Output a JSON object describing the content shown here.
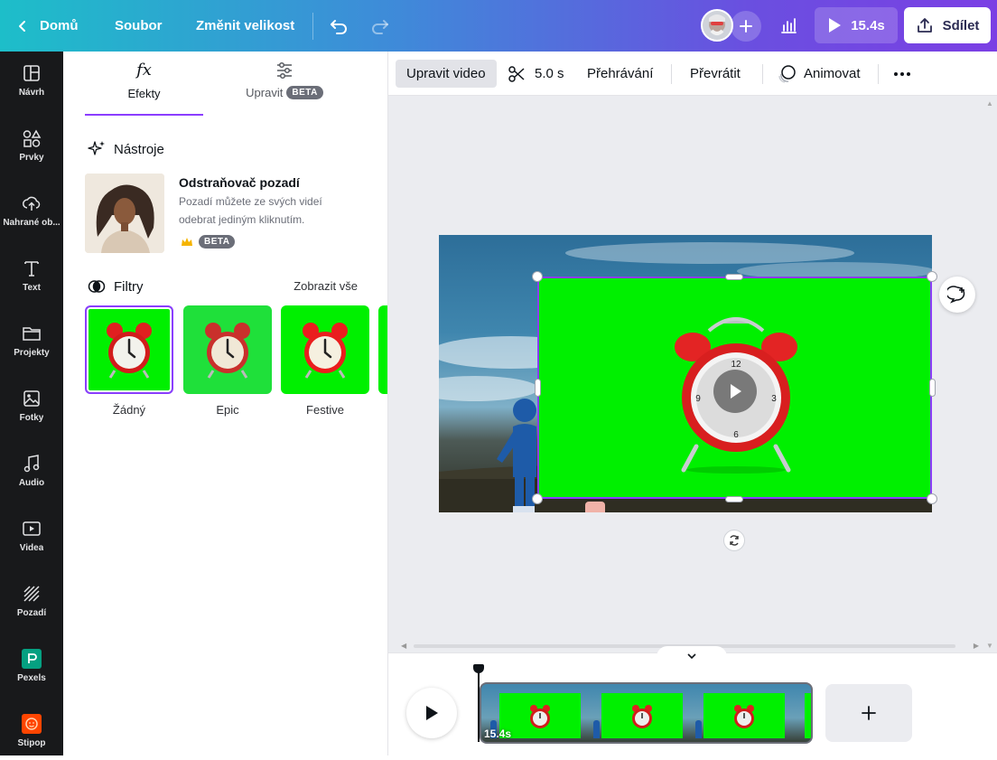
{
  "topbar": {
    "home": "Domů",
    "file": "Soubor",
    "resize": "Změnit velikost",
    "duration": "15.4s",
    "share": "Sdílet",
    "icons": [
      "chevron-left-icon",
      "undo-icon",
      "redo-icon",
      "plus-icon",
      "analytics-icon",
      "play-icon",
      "share-icon"
    ]
  },
  "sidenav": {
    "items": [
      {
        "label": "Návrh",
        "icon": "design-icon"
      },
      {
        "label": "Prvky",
        "icon": "elements-icon"
      },
      {
        "label": "Nahrané ob...",
        "icon": "upload-icon"
      },
      {
        "label": "Text",
        "icon": "text-icon"
      },
      {
        "label": "Projekty",
        "icon": "folder-icon"
      },
      {
        "label": "Fotky",
        "icon": "photo-icon"
      },
      {
        "label": "Audio",
        "icon": "music-icon"
      },
      {
        "label": "Videa",
        "icon": "video-icon"
      },
      {
        "label": "Pozadí",
        "icon": "background-icon"
      },
      {
        "label": "Pexels",
        "icon": "pexels-icon"
      },
      {
        "label": "Stipop",
        "icon": "stipop-icon"
      }
    ]
  },
  "panel": {
    "tabs": {
      "effects": "Efekty",
      "effects_icon": "fx",
      "adjust": "Upravit",
      "adjust_badge": "BETA"
    },
    "tools_title": "Nástroje",
    "bg_remover": {
      "title": "Odstraňovač pozadí",
      "desc_line1": "Pozadí můžete ze svých videí",
      "desc_line2": "odebrat jediným kliknutím.",
      "badge": "BETA"
    },
    "filters_title": "Filtry",
    "see_all": "Zobrazit vše",
    "filters": [
      {
        "label": "Žádný",
        "selected": true
      },
      {
        "label": "Epic",
        "selected": false
      },
      {
        "label": "Festive",
        "selected": false
      }
    ]
  },
  "toolbar": {
    "edit_video": "Upravit video",
    "duration": "5.0 s",
    "playback": "Přehrávání",
    "flip": "Převrátit",
    "animate": "Animovat"
  },
  "timeline": {
    "clip_duration": "15.4s"
  },
  "colors": {
    "accent": "#8b3dff",
    "green_screen": "#00f000",
    "sidebar_bg": "#18191b"
  }
}
